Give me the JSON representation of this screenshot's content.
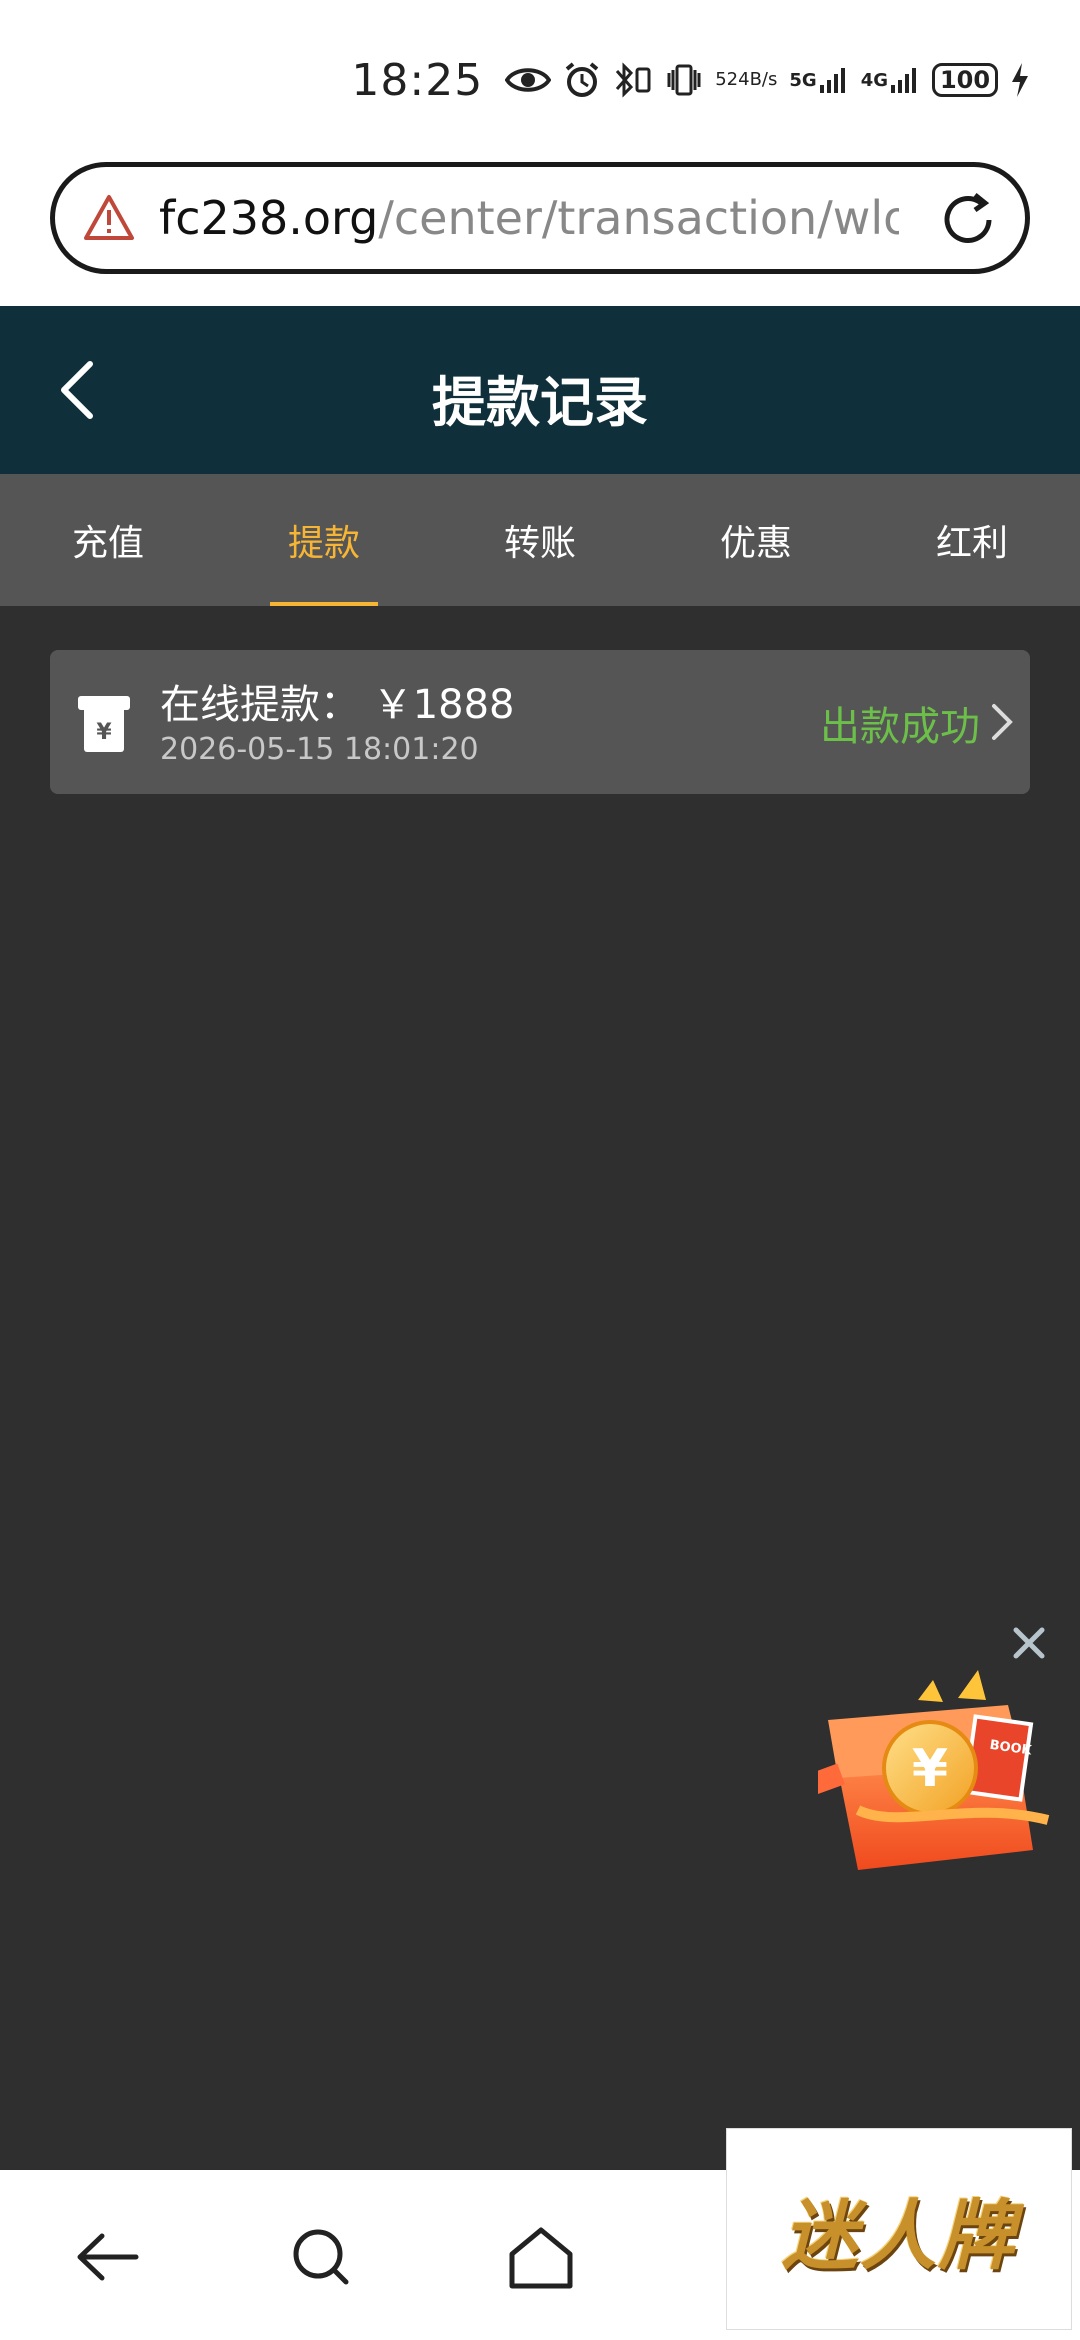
{
  "status_bar": {
    "time": "18:25",
    "net_speed_value": "524",
    "net_speed_unit": "B/s",
    "net_5g": "5G",
    "net_4g": "4G",
    "battery": "100"
  },
  "browser": {
    "url_host": "fc238.org",
    "url_path": "/center/transaction/wlog"
  },
  "header": {
    "title": "提款记录"
  },
  "tabs": [
    {
      "label": "充值"
    },
    {
      "label": "提款"
    },
    {
      "label": "转账"
    },
    {
      "label": "优惠"
    },
    {
      "label": "红利"
    }
  ],
  "active_tab": "提款",
  "record": {
    "title": "在线提款： ￥1888",
    "date": "2026-05-15 18:01:20",
    "status": "出款成功",
    "status_color": "#6cc04a"
  },
  "gift_widget": {
    "coin_symbol": "¥",
    "book_label": "BOOK"
  },
  "logo": {
    "text": "迷人牌"
  },
  "colors": {
    "header_bg": "#0f303a",
    "tab_bg": "#555555",
    "accent": "#f7b535",
    "page_bg": "#2f2f2f"
  }
}
